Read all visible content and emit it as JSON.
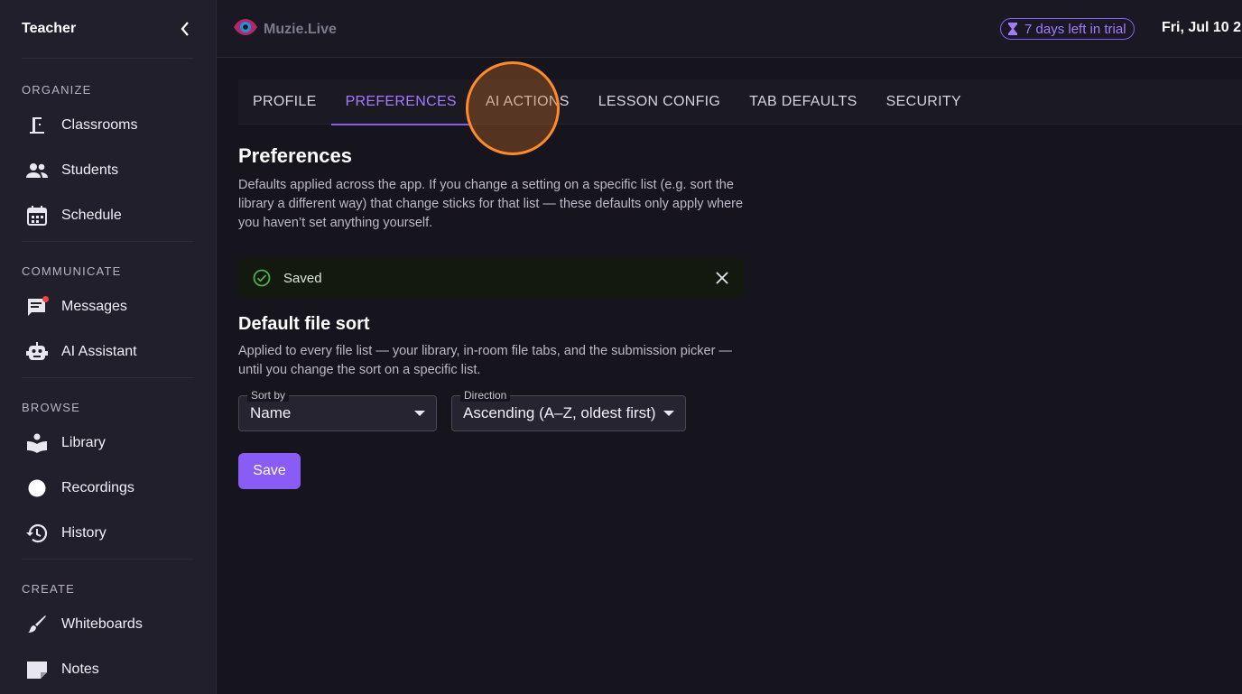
{
  "sidebar": {
    "title": "Teacher",
    "sections": [
      {
        "label": "ORGANIZE",
        "items": [
          {
            "label": "Classrooms",
            "icon": "door-icon"
          },
          {
            "label": "Students",
            "icon": "people-icon"
          },
          {
            "label": "Schedule",
            "icon": "calendar-icon"
          }
        ]
      },
      {
        "label": "COMMUNICATE",
        "items": [
          {
            "label": "Messages",
            "icon": "message-icon"
          },
          {
            "label": "AI Assistant",
            "icon": "robot-icon"
          }
        ]
      },
      {
        "label": "BROWSE",
        "items": [
          {
            "label": "Library",
            "icon": "book-icon"
          },
          {
            "label": "Recordings",
            "icon": "record-icon"
          },
          {
            "label": "History",
            "icon": "history-icon"
          }
        ]
      },
      {
        "label": "CREATE",
        "items": [
          {
            "label": "Whiteboards",
            "icon": "brush-icon"
          },
          {
            "label": "Notes",
            "icon": "note-icon"
          }
        ]
      }
    ]
  },
  "topbar": {
    "logo_text": "Muzie.Live",
    "trial_label": "7 days left in trial",
    "date": "Fri, Jul 10 2"
  },
  "tabs": [
    {
      "label": "PROFILE",
      "active": false
    },
    {
      "label": "PREFERENCES",
      "active": true
    },
    {
      "label": "AI ACTIONS",
      "active": false
    },
    {
      "label": "LESSON CONFIG",
      "active": false
    },
    {
      "label": "TAB DEFAULTS",
      "active": false
    },
    {
      "label": "SECURITY",
      "active": false
    }
  ],
  "preferences": {
    "title": "Preferences",
    "description": "Defaults applied across the app. If you change a setting on a specific list (e.g. sort the library a different way) that change sticks for that list — these defaults only apply where you haven’t set anything yourself.",
    "alert": "Saved"
  },
  "file_sort": {
    "title": "Default file sort",
    "description": "Applied to every file list — your library, in-room file tabs, and the submission picker — until you change the sort on a specific list.",
    "sort_by": {
      "caption": "Sort by",
      "value": "Name"
    },
    "direction": {
      "caption": "Direction",
      "value": "Ascending (A–Z, oldest first)"
    },
    "save_label": "Save"
  },
  "colors": {
    "accent": "#8a5cf6",
    "success": "#4caf50",
    "background": "#16141c",
    "sidebar": "#211f2c"
  }
}
